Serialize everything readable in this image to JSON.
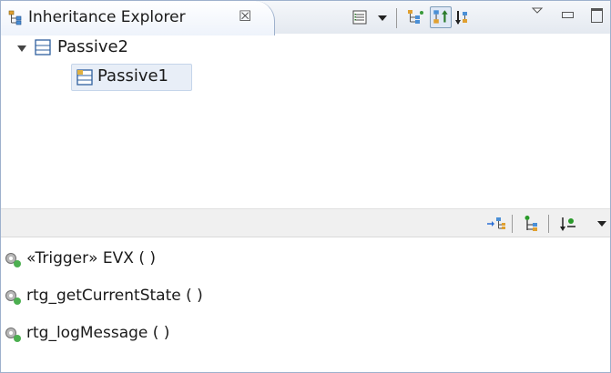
{
  "view": {
    "title": "Inheritance Explorer",
    "close_glyph": "☒",
    "toolbar_icons": [
      "columns-icon",
      "supertype-hierarchy-icon",
      "subtype-hierarchy-icon",
      "type-hierarchy-icon"
    ]
  },
  "tree": {
    "root": {
      "label": "Passive2",
      "expanded": true,
      "icon": "class-icon"
    },
    "child": {
      "label": "Passive1",
      "selected": true,
      "icon": "class-icon"
    }
  },
  "members_toolbar_icons": [
    "show-inherited-icon",
    "lock-view-icon",
    "sort-members-icon"
  ],
  "members": [
    {
      "label": "«Trigger» EVX ( )",
      "icon": "operation-icon"
    },
    {
      "label": "rtg_getCurrentState ( )",
      "icon": "operation-icon"
    },
    {
      "label": "rtg_logMessage ( )",
      "icon": "operation-icon"
    }
  ],
  "colors": {
    "border": "#9eb1cd",
    "selection": "#e8eef7",
    "operation_green": "#4caf50"
  }
}
